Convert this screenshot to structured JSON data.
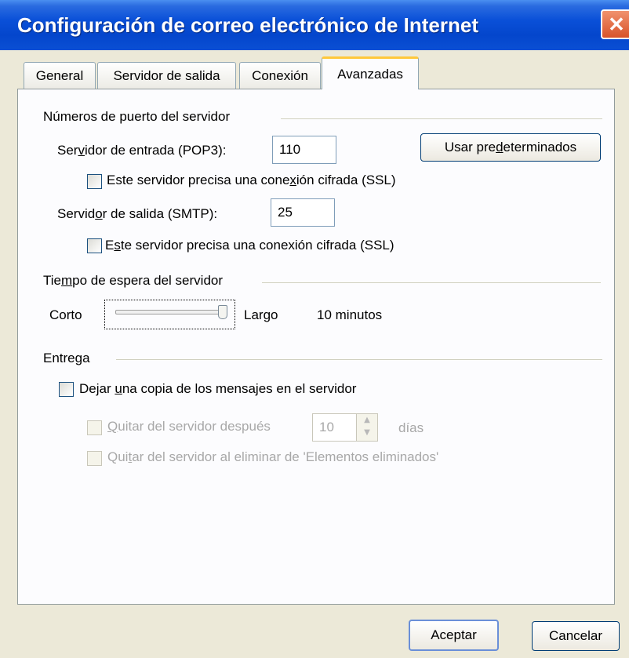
{
  "window": {
    "title": "Configuración de correo electrónico de Internet"
  },
  "tabs": [
    {
      "label": "General",
      "active": false
    },
    {
      "label": "Servidor de salida",
      "active": false
    },
    {
      "label": "Conexión",
      "active": false
    },
    {
      "label": "Avanzadas",
      "active": true
    }
  ],
  "ports": {
    "group_label": "Números de puerto del servidor",
    "incoming": {
      "label_a": "Ser",
      "label_key": "v",
      "label_b": "idor de entrada (POP3):",
      "value": "110",
      "ssl_a": "Este servidor precisa una cone",
      "ssl_key": "x",
      "ssl_b": "ión cifrada (SSL)",
      "ssl_checked": false
    },
    "outgoing": {
      "label_a": "Servid",
      "label_key": "o",
      "label_b": "r de salida (SMTP):",
      "value": "25",
      "ssl_a": "E",
      "ssl_key": "s",
      "ssl_b": "te servidor precisa una conexión cifrada (SSL)",
      "ssl_checked": false
    },
    "defaults_a": "Usar pre",
    "defaults_key": "d",
    "defaults_b": "eterminados"
  },
  "timeout": {
    "group_label_a": "Tie",
    "group_label_key": "m",
    "group_label_b": "po de espera del servidor",
    "short_label": "Corto",
    "long_label": "Largo",
    "value_text": "10 minutos",
    "level_fraction": 1.0
  },
  "delivery": {
    "group_label": "Entrega",
    "leave_copy_a": "Dejar ",
    "leave_copy_key": "u",
    "leave_copy_b": "na copia de los mensajes en el servidor",
    "leave_copy_checked": false,
    "remove_after_key": "Q",
    "remove_after_b": "uitar del servidor después",
    "remove_after_days": "10",
    "days_label": "días",
    "remove_deleted_a": "Qui",
    "remove_deleted_key": "t",
    "remove_deleted_b": "ar del servidor al eliminar de 'Elementos eliminados'"
  },
  "footer": {
    "ok_label": "Aceptar",
    "cancel_label": "Cancelar"
  },
  "colors": {
    "titlebar": "#0a50d8",
    "dialog_bg": "#ece9d8",
    "panel_bg": "#fcfcfe",
    "tab_highlight": "#ffc83c",
    "close_button": "#d8532a"
  },
  "icons": {
    "close": "close-icon",
    "spin_up": "chevron-up-icon",
    "spin_down": "chevron-down-icon"
  }
}
